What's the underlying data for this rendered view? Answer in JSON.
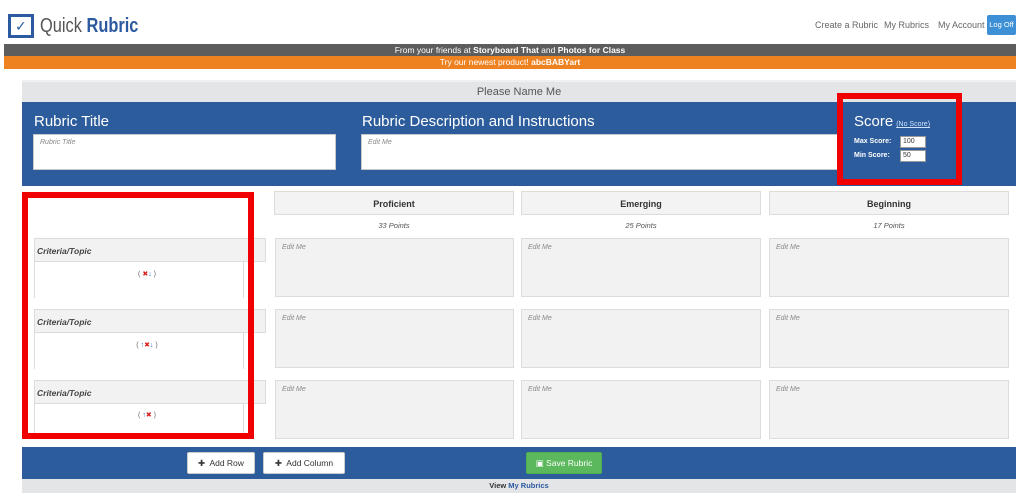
{
  "header": {
    "logo_quick": "Quick",
    "logo_rubric": "Rubric",
    "logo_icon": "rubric-check-icon",
    "nav": [
      "Create a Rubric",
      "My Rubrics",
      "My Account"
    ],
    "logoff": "Log Off"
  },
  "banner": {
    "line1_prefix": "From your friends at ",
    "line1_storyboard": "Storyboard That",
    "line1_and": " and ",
    "line1_photos": "Photos for Class",
    "line2_prefix": "Try our newest product! ",
    "line2_product": "abcBABYart"
  },
  "rubric": {
    "name": "Please Name Me",
    "title_label": "Rubric Title",
    "title_placeholder": "Rubric Title",
    "desc_label": "Rubric Description and Instructions",
    "desc_placeholder": "Edit Me",
    "score_label": "Score",
    "no_score": "(No Score)",
    "max_label": "Max Score:",
    "max_value": "100",
    "min_label": "Min Score:",
    "min_value": "50"
  },
  "columns": [
    {
      "label": "Proficient",
      "points": "33 Points"
    },
    {
      "label": "Emerging",
      "points": "25 Points"
    },
    {
      "label": "Beginning",
      "points": "17 Points"
    }
  ],
  "rows": [
    {
      "criteria": "Criteria/Topic",
      "cells": [
        "Edit Me",
        "Edit Me",
        "Edit Me"
      ]
    },
    {
      "criteria": "Criteria/Topic",
      "cells": [
        "Edit Me",
        "Edit Me",
        "Edit Me"
      ]
    },
    {
      "criteria": "Criteria/Topic",
      "cells": [
        "Edit Me",
        "Edit Me",
        "Edit Me"
      ]
    }
  ],
  "footer": {
    "add_row": "Add Row",
    "add_column": "Add Column",
    "save": "Save Rubric",
    "view_prefix": "View ",
    "view_link": "My Rubrics"
  },
  "colors": {
    "brand_blue": "#2c5c9c",
    "banner_gray": "#5d5d5d",
    "banner_orange": "#ef8220",
    "highlight_red": "#f00000",
    "save_green": "#5cb85c"
  }
}
